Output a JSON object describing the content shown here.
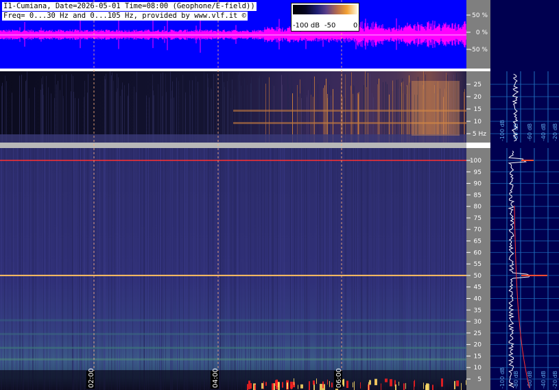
{
  "header": {
    "line1": "I1-Cumiana, Date=2026-05-01 Time=08:00 (Geophone/E-field))",
    "line2": "Freq= 0...30 Hz and 0...105 Hz, provided by www.vlf.it ©"
  },
  "colorbar": {
    "labels": [
      "-100 dB",
      "-50",
      "0"
    ]
  },
  "colors": {
    "waveform_bg": "#0000ff",
    "waveform_trace": "#ff00ff",
    "spectrogram_dark": "#0c0c22",
    "spectrogram_mid": "#30306e",
    "spectrum_panel_bg": "#000050",
    "spectrum_grid": "#1f6fbf",
    "label_bg": "#7f7f7f",
    "marker_line": "#ffb080"
  },
  "chart_data": [
    {
      "type": "line",
      "panel": "waveform",
      "y_ticks": [
        "50 %",
        "0 %",
        "-50 %"
      ],
      "ylim": [
        -100,
        100
      ]
    },
    {
      "type": "heatmap",
      "panel": "spectrogram-low",
      "yticks": [
        25,
        20,
        15,
        10
      ],
      "y_unit_label": "5 Hz",
      "ylim": [
        0,
        30
      ],
      "spectrum_axis_labels": [
        "-100 dB",
        "-80 dB",
        "-60 dB",
        "-40 dB",
        "-20 dB"
      ]
    },
    {
      "type": "heatmap",
      "panel": "spectrogram-high",
      "yticks": [
        100,
        95,
        90,
        85,
        80,
        75,
        70,
        65,
        60,
        55,
        50,
        45,
        40,
        35,
        30,
        25,
        20,
        15,
        10,
        5
      ],
      "ylim": [
        0,
        105
      ],
      "time_markers": [
        "02:00",
        "04:00",
        "06:00"
      ],
      "spectrum_axis_labels": [
        "-100 dB",
        "-80 dB",
        "-60 dB",
        "-40 dB",
        "-20 dB"
      ]
    }
  ]
}
